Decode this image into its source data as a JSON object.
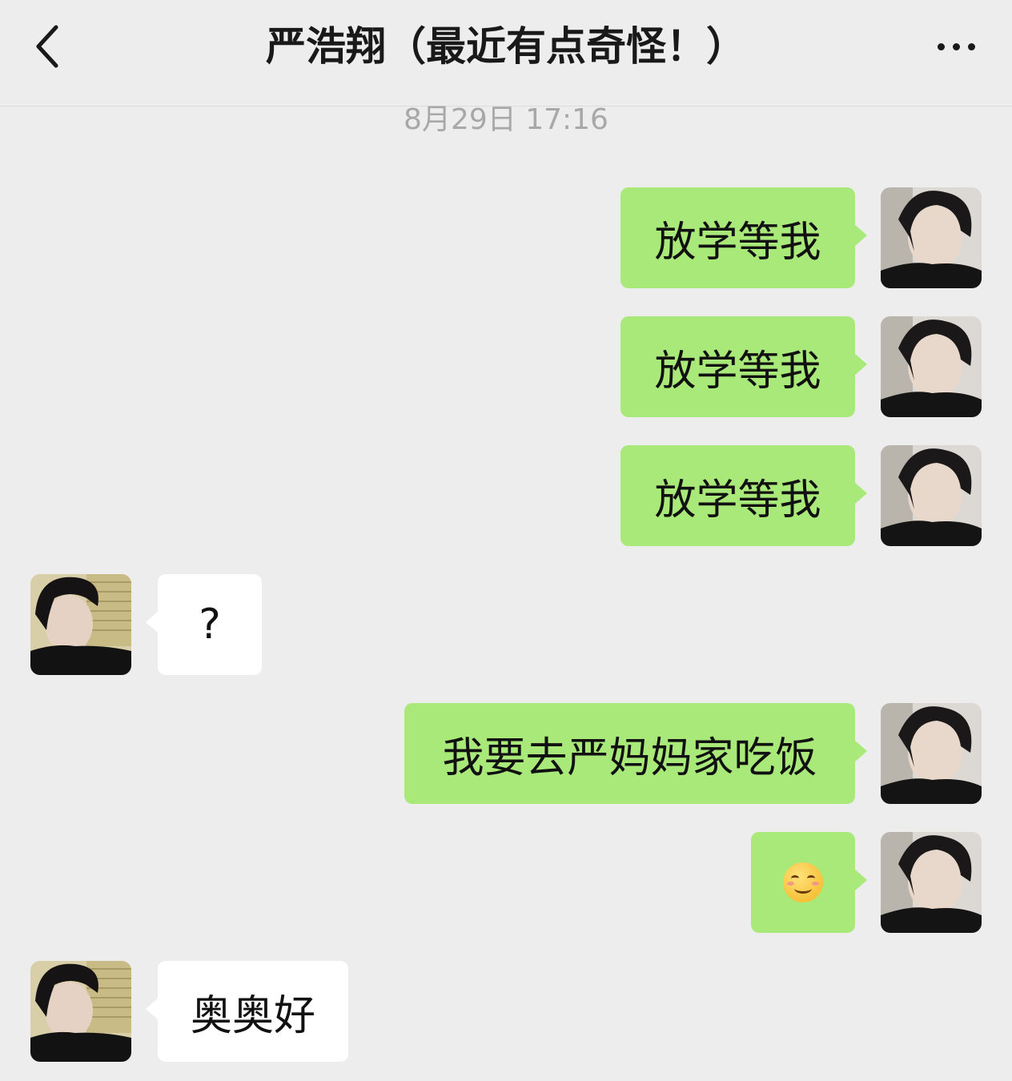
{
  "header": {
    "title": "严浩翔（最近有点奇怪！）",
    "back_icon": "chevron-left-icon",
    "more_icon": "more-dots-icon"
  },
  "timestamp": "8月29日 17:16",
  "colors": {
    "background": "#ededed",
    "outgoing_bubble": "#a9e97a",
    "incoming_bubble": "#ffffff"
  },
  "messages": [
    {
      "direction": "out",
      "text": "放学等我"
    },
    {
      "direction": "out",
      "text": "放学等我"
    },
    {
      "direction": "out",
      "text": "放学等我"
    },
    {
      "direction": "in",
      "text": "?"
    },
    {
      "direction": "out",
      "text": "我要去严妈妈家吃饭"
    },
    {
      "direction": "out",
      "text": "☺️",
      "emoji": "smiling-face-icon"
    },
    {
      "direction": "in",
      "text": "奥奥好"
    }
  ]
}
